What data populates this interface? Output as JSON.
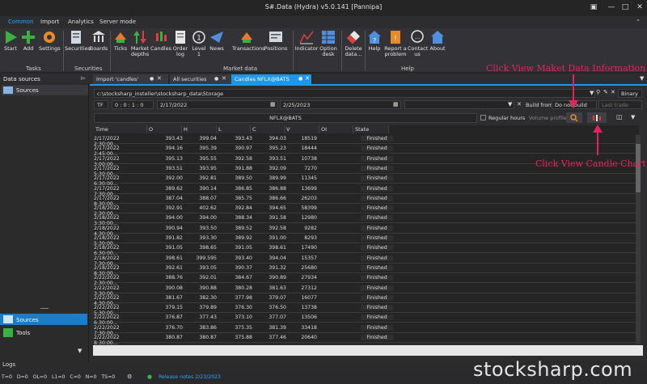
{
  "window": {
    "title": "S#.Data (Hydra) v5.0.141 [Pannipa]"
  },
  "ribbon_tabs": [
    "Common",
    "Import",
    "Analytics",
    "Server mode"
  ],
  "ribbon_buttons": [
    {
      "label": "Start",
      "icon": "play-icon"
    },
    {
      "label": "Add",
      "icon": "add-icon"
    },
    {
      "label": "Settings",
      "icon": "gear-icon"
    },
    {
      "label": "Securities",
      "icon": "securities-icon"
    },
    {
      "label": "Boards",
      "icon": "boards-icon"
    },
    {
      "label": "Ticks",
      "icon": "ticks-icon"
    },
    {
      "label": "Market depths",
      "icon": "market-depths-icon"
    },
    {
      "label": "Candles",
      "icon": "candles-icon"
    },
    {
      "label": "Order log",
      "icon": "order-log-icon"
    },
    {
      "label": "Level 1",
      "icon": "level1-icon"
    },
    {
      "label": "News",
      "icon": "news-icon"
    },
    {
      "label": "Transactions",
      "icon": "transactions-icon"
    },
    {
      "label": "Positions",
      "icon": "positions-icon"
    },
    {
      "label": "Indicator",
      "icon": "indicator-icon"
    },
    {
      "label": "Option desk",
      "icon": "option-desk-icon"
    },
    {
      "label": "Delete data...",
      "icon": "eraser-icon"
    },
    {
      "label": "Help",
      "icon": "help-icon"
    },
    {
      "label": "Report a problem",
      "icon": "report-icon"
    },
    {
      "label": "Contact us",
      "icon": "contact-icon"
    },
    {
      "label": "About",
      "icon": "about-icon"
    }
  ],
  "ribbon_groups": [
    "Tasks",
    "Securities",
    "Market data",
    "Help"
  ],
  "left_panel": {
    "title": "Data sources",
    "items": [
      "Sources"
    ],
    "bottom_items": [
      "Sources",
      "Tools"
    ]
  },
  "doc_tabs": [
    "Import 'candles'",
    "All securities",
    "Candles NFLX@BATS"
  ],
  "storage": {
    "path": "c:\\stocksharp_insteller\\stocksharp_data\\Storage",
    "format": "Binary"
  },
  "filters": {
    "tf": "TF",
    "timeframe": "0 : 0 : 1 : 0",
    "from_date": "2/17/2022",
    "to_date": "2/25/2023",
    "build_from_label": "Build from:",
    "build_from_value": "Do not build",
    "last_trade": "Last trade",
    "security": "NFLX@BATS",
    "regular_hours": "Regular hours",
    "volume_profile": "Volume profile"
  },
  "table": {
    "columns": [
      "Time",
      "O",
      "H",
      "L",
      "C",
      "V",
      "OI",
      "State"
    ],
    "rows": [
      [
        "2/17/2022 2:30:00...",
        "393.43",
        "399.04",
        "393.43",
        "394.03",
        "18519",
        "",
        "Finished"
      ],
      [
        "2/17/2022 2:45:00...",
        "394.16",
        "395.39",
        "390.97",
        "395.23",
        "18444",
        "",
        "Finished"
      ],
      [
        "2/17/2022 3:00:00...",
        "395.13",
        "395.55",
        "392.58",
        "393.51",
        "10738",
        "",
        "Finished"
      ],
      [
        "2/17/2022 5:30:00...",
        "393.51",
        "393.95",
        "391.88",
        "392.09",
        "7270",
        "",
        "Finished"
      ],
      [
        "2/17/2022 6:30:00...",
        "392.00",
        "392.81",
        "389.50",
        "389.99",
        "11345",
        "",
        "Finished"
      ],
      [
        "2/17/2022 7:30:00...",
        "389.62",
        "390.14",
        "386.85",
        "386.88",
        "13699",
        "",
        "Finished"
      ],
      [
        "2/17/2022 8:30:00...",
        "387.04",
        "388.07",
        "385.75",
        "386.66",
        "26203",
        "",
        "Finished"
      ],
      [
        "2/18/2022 2:30:00...",
        "392.91",
        "402.62",
        "392.84",
        "394.65",
        "58399",
        "",
        "Finished"
      ],
      [
        "2/18/2022 3:30:00...",
        "394.00",
        "394.00",
        "388.34",
        "391.58",
        "12980",
        "",
        "Finished"
      ],
      [
        "2/18/2022 4:30:00...",
        "390.94",
        "393.50",
        "389.52",
        "392.58",
        "9282",
        "",
        "Finished"
      ],
      [
        "2/18/2022 5:30:00...",
        "391.82",
        "393.30",
        "389.92",
        "391.00",
        "8293",
        "",
        "Finished"
      ],
      [
        "2/18/2022 6:30:00...",
        "391.05",
        "398.65",
        "391.05",
        "398.61",
        "17490",
        "",
        "Finished"
      ],
      [
        "2/18/2022 7:30:00...",
        "398.61",
        "399.595",
        "393.40",
        "394.04",
        "15357",
        "",
        "Finished"
      ],
      [
        "2/18/2022 8:30:00...",
        "392.61",
        "393.05",
        "390.37",
        "391.32",
        "25680",
        "",
        "Finished"
      ],
      [
        "2/22/2022 2:30:00...",
        "388.76",
        "392.01",
        "384.67",
        "390.89",
        "27934",
        "",
        "Finished"
      ],
      [
        "2/22/2022 3:30:00...",
        "390.08",
        "390.88",
        "380.28",
        "381.63",
        "27312",
        "",
        "Finished"
      ],
      [
        "2/22/2022 4:30:00...",
        "381.67",
        "382.30",
        "377.98",
        "379.07",
        "16077",
        "",
        "Finished"
      ],
      [
        "2/22/2022 5:30:00...",
        "379.15",
        "379.89",
        "376.30",
        "376.50",
        "13738",
        "",
        "Finished"
      ],
      [
        "2/22/2022 6:30:00...",
        "376.87",
        "377.43",
        "373.10",
        "377.07",
        "13506",
        "",
        "Finished"
      ],
      [
        "2/22/2022 7:30:00...",
        "376.70",
        "383.86",
        "375.35",
        "381.39",
        "33418",
        "",
        "Finished"
      ],
      [
        "2/22/2022 8:30:00...",
        "380.87",
        "380.87",
        "375.88",
        "377.46",
        "20640",
        "",
        "Finished"
      ]
    ]
  },
  "annotations": {
    "market_data": "Click View Maket Data Information",
    "candle_chart": "Click View Candle Chart"
  },
  "status_bar": {
    "values": [
      "T=0",
      "D=0",
      "OL=0",
      "L1=0",
      "C=0",
      "N=0",
      "TS=0"
    ],
    "release": "Release notes 2/23/2023"
  },
  "logs_label": "Logs",
  "watermark": "stocksharp.com",
  "colors": {
    "accent": "#1c97ea",
    "annotation": "#e3245b",
    "green": "#3cb043"
  }
}
